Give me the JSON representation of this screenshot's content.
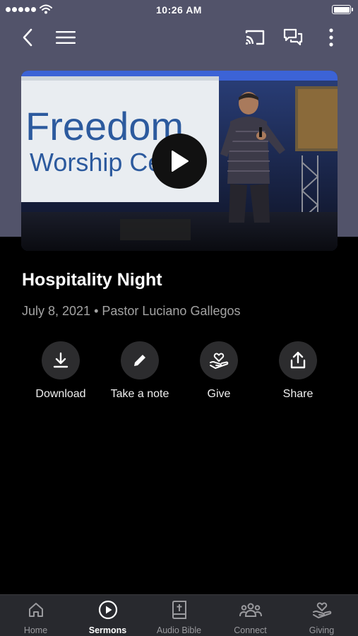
{
  "status_bar": {
    "time": "10:26 AM"
  },
  "top_nav": {
    "back_icon": "chevron-left-icon",
    "menu_icon": "hamburger-menu-icon",
    "cast_icon": "cast-icon",
    "chat_icon": "chat-bubbles-icon",
    "more_icon": "more-vertical-icon"
  },
  "video": {
    "banner_line1": "Freedom",
    "banner_line2": "Worship Center",
    "play_icon": "play-icon"
  },
  "sermon": {
    "title": "Hospitality Night",
    "meta": "July 8, 2021 • Pastor Luciano Gallegos"
  },
  "actions": [
    {
      "label": "Download",
      "icon": "download-icon"
    },
    {
      "label": "Take a note",
      "icon": "pencil-icon"
    },
    {
      "label": "Give",
      "icon": "heart-hand-icon"
    },
    {
      "label": "Share",
      "icon": "share-icon"
    }
  ],
  "tab_bar": {
    "active": "Sermons",
    "tabs": [
      {
        "label": "Home",
        "icon": "home-icon"
      },
      {
        "label": "Sermons",
        "icon": "play-circle-icon"
      },
      {
        "label": "Audio Bible",
        "icon": "bible-icon"
      },
      {
        "label": "Connect",
        "icon": "people-icon"
      },
      {
        "label": "Giving",
        "icon": "heart-hand-icon"
      }
    ]
  },
  "colors": {
    "header_bg": "#52536a",
    "page_bg": "#000000",
    "action_circle": "#2c2c2e",
    "tab_bar_bg": "#28292e",
    "meta_text": "#a3a3a3"
  }
}
